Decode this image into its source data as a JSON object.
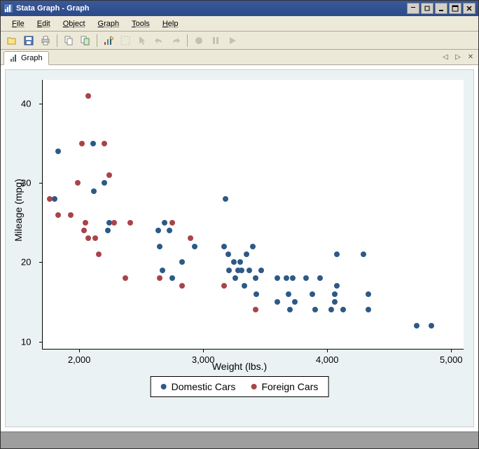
{
  "window": {
    "title": "Stata Graph - Graph"
  },
  "menu": {
    "items": [
      "File",
      "Edit",
      "Object",
      "Graph",
      "Tools",
      "Help"
    ]
  },
  "tab": {
    "label": "Graph"
  },
  "chart_data": {
    "type": "scatter",
    "xlabel": "Weight (lbs.)",
    "ylabel": "Mileage (mpg)",
    "xlim": [
      1700,
      5100
    ],
    "ylim": [
      9,
      43
    ],
    "xticks": [
      2000,
      3000,
      4000,
      5000
    ],
    "yticks": [
      10,
      20,
      30,
      40
    ],
    "xtick_labels": [
      "2,000",
      "3,000",
      "4,000",
      "5,000"
    ],
    "ytick_labels": [
      "10",
      "20",
      "30",
      "40"
    ],
    "series": [
      {
        "name": "Domestic Cars",
        "color": "#2d5986",
        "points": [
          {
            "x": 1800,
            "y": 28
          },
          {
            "x": 1830,
            "y": 34
          },
          {
            "x": 2110,
            "y": 35
          },
          {
            "x": 2120,
            "y": 29
          },
          {
            "x": 2200,
            "y": 30
          },
          {
            "x": 2230,
            "y": 24
          },
          {
            "x": 2240,
            "y": 25
          },
          {
            "x": 2640,
            "y": 24
          },
          {
            "x": 2650,
            "y": 22
          },
          {
            "x": 2670,
            "y": 19
          },
          {
            "x": 2690,
            "y": 25
          },
          {
            "x": 2730,
            "y": 24
          },
          {
            "x": 2750,
            "y": 18
          },
          {
            "x": 2830,
            "y": 20
          },
          {
            "x": 2930,
            "y": 22
          },
          {
            "x": 3170,
            "y": 22
          },
          {
            "x": 3180,
            "y": 28
          },
          {
            "x": 3200,
            "y": 21
          },
          {
            "x": 3210,
            "y": 19
          },
          {
            "x": 3250,
            "y": 20
          },
          {
            "x": 3260,
            "y": 18
          },
          {
            "x": 3280,
            "y": 19
          },
          {
            "x": 3300,
            "y": 20
          },
          {
            "x": 3310,
            "y": 19
          },
          {
            "x": 3330,
            "y": 17
          },
          {
            "x": 3350,
            "y": 21
          },
          {
            "x": 3370,
            "y": 19
          },
          {
            "x": 3400,
            "y": 22
          },
          {
            "x": 3420,
            "y": 18
          },
          {
            "x": 3430,
            "y": 16
          },
          {
            "x": 3470,
            "y": 19
          },
          {
            "x": 3600,
            "y": 18
          },
          {
            "x": 3600,
            "y": 15
          },
          {
            "x": 3670,
            "y": 18
          },
          {
            "x": 3690,
            "y": 16
          },
          {
            "x": 3700,
            "y": 14
          },
          {
            "x": 3720,
            "y": 18
          },
          {
            "x": 3740,
            "y": 15
          },
          {
            "x": 3830,
            "y": 18
          },
          {
            "x": 3880,
            "y": 16
          },
          {
            "x": 3900,
            "y": 14
          },
          {
            "x": 3940,
            "y": 18
          },
          {
            "x": 4030,
            "y": 14
          },
          {
            "x": 4060,
            "y": 15
          },
          {
            "x": 4060,
            "y": 16
          },
          {
            "x": 4080,
            "y": 17
          },
          {
            "x": 4080,
            "y": 21
          },
          {
            "x": 4130,
            "y": 14
          },
          {
            "x": 4290,
            "y": 21
          },
          {
            "x": 4330,
            "y": 16
          },
          {
            "x": 4330,
            "y": 14
          },
          {
            "x": 4720,
            "y": 12
          },
          {
            "x": 4840,
            "y": 12
          }
        ]
      },
      {
        "name": "Foreign Cars",
        "color": "#a84449",
        "points": [
          {
            "x": 1760,
            "y": 28
          },
          {
            "x": 1830,
            "y": 26
          },
          {
            "x": 1930,
            "y": 26
          },
          {
            "x": 1990,
            "y": 30
          },
          {
            "x": 2020,
            "y": 35
          },
          {
            "x": 2040,
            "y": 24
          },
          {
            "x": 2050,
            "y": 25
          },
          {
            "x": 2070,
            "y": 41
          },
          {
            "x": 2070,
            "y": 23
          },
          {
            "x": 2130,
            "y": 23
          },
          {
            "x": 2160,
            "y": 21
          },
          {
            "x": 2200,
            "y": 35
          },
          {
            "x": 2240,
            "y": 31
          },
          {
            "x": 2280,
            "y": 25
          },
          {
            "x": 2370,
            "y": 18
          },
          {
            "x": 2410,
            "y": 25
          },
          {
            "x": 2650,
            "y": 18
          },
          {
            "x": 2750,
            "y": 25
          },
          {
            "x": 2830,
            "y": 17
          },
          {
            "x": 2900,
            "y": 23
          },
          {
            "x": 3170,
            "y": 17
          },
          {
            "x": 3420,
            "y": 14
          }
        ]
      }
    ]
  },
  "legend": {
    "items": [
      {
        "label": "Domestic Cars",
        "color": "#2d5986"
      },
      {
        "label": "Foreign Cars",
        "color": "#a84449"
      }
    ]
  }
}
